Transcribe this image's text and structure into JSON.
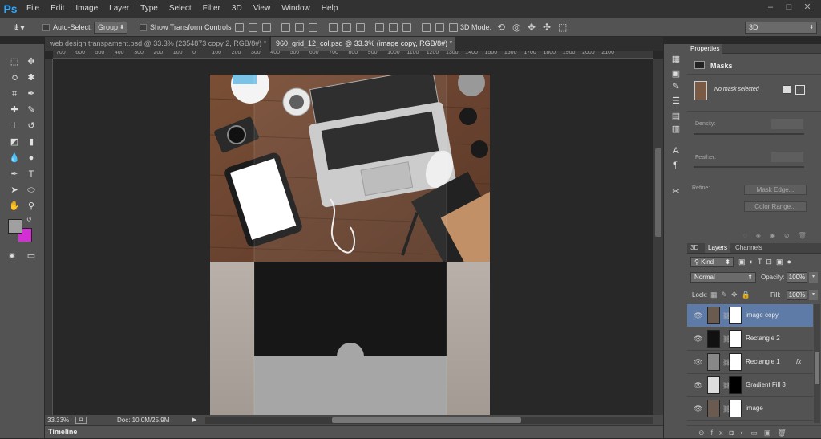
{
  "app": {
    "logo": "Ps"
  },
  "menu": [
    "File",
    "Edit",
    "Image",
    "Layer",
    "Type",
    "Select",
    "Filter",
    "3D",
    "View",
    "Window",
    "Help"
  ],
  "window_controls": {
    "minimize": "–",
    "restore": "□",
    "close": "✕"
  },
  "options": {
    "auto_select_label": "Auto-Select:",
    "auto_select_value": "Group",
    "show_transform_label": "Show Transform Controls",
    "mode_3d_label": "3D Mode:",
    "workspace": "3D"
  },
  "tabs": [
    {
      "label": "web design transpament.psd @ 33.3% (2354873 copy 2, RGB/8#) *",
      "active": false
    },
    {
      "label": "960_grid_12_col.psd @ 33.3% (image copy, RGB/8#) *",
      "active": true
    }
  ],
  "ruler_h": [
    "700",
    "600",
    "500",
    "400",
    "300",
    "200",
    "100",
    "0",
    "100",
    "200",
    "300",
    "400",
    "500",
    "600",
    "700",
    "800",
    "900",
    "1000",
    "1100",
    "1200",
    "1300",
    "1400",
    "1500",
    "1600",
    "1700",
    "1800",
    "1900",
    "2000",
    "2100"
  ],
  "status": {
    "zoom": "33.33%",
    "doc": "Doc: 10.0M/25.9M"
  },
  "timeline_label": "Timeline",
  "properties": {
    "tab": "Properties",
    "title": "Masks",
    "mask_status": "No mask selected",
    "density_label": "Density:",
    "feather_label": "Feather:",
    "refine_label": "Refine:",
    "mask_edge_btn": "Mask Edge...",
    "color_range_btn": "Color Range..."
  },
  "layers_panel": {
    "tabs": [
      "3D",
      "Layers",
      "Channels"
    ],
    "kind_label": "Kind",
    "blend_mode": "Normal",
    "opacity_label": "Opacity:",
    "opacity_value": "100%",
    "lock_label": "Lock:",
    "fill_label": "Fill:",
    "fill_value": "100%",
    "layers": [
      {
        "name": "image copy",
        "selected": true,
        "fx": ""
      },
      {
        "name": "Rectangle 2",
        "selected": false,
        "fx": ""
      },
      {
        "name": "Rectangle 1",
        "selected": false,
        "fx": "fx"
      },
      {
        "name": "Gradient Fill 3",
        "selected": false,
        "fx": ""
      },
      {
        "name": "image",
        "selected": false,
        "fx": ""
      }
    ]
  },
  "colors": {
    "foreground": "#a0a0a0",
    "background": "#d42fd4",
    "selected_layer": "#5d7ba6",
    "ps_blue": "#31a8ff"
  }
}
